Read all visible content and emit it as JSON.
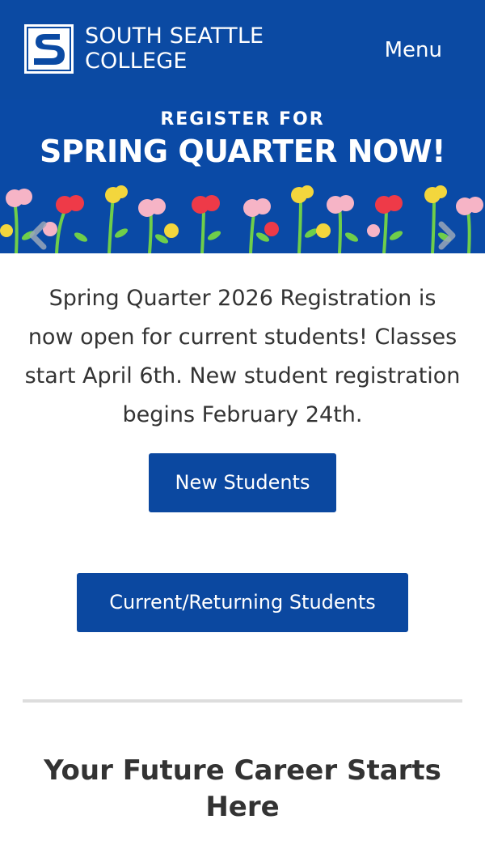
{
  "header": {
    "logo_line1": "SOUTH SEATTLE",
    "logo_line2": "COLLEGE",
    "menu_label": "Menu"
  },
  "banner": {
    "kicker": "REGISTER FOR",
    "title": "SPRING QUARTER NOW!",
    "prev_icon": "chevron-left-icon",
    "next_icon": "chevron-right-icon"
  },
  "main": {
    "intro": "Spring Quarter 2026 Registration is now open for current students! Classes start April 6th. New student registration begins February 24th.",
    "new_students_label": "New Students",
    "current_students_label": "Current/Returning Students",
    "section_heading": "Your Future Career Starts Here"
  },
  "colors": {
    "brand_blue": "#0b4aa3",
    "button_blue": "#0b48a0",
    "text": "#333333",
    "divider": "#dddddd"
  }
}
